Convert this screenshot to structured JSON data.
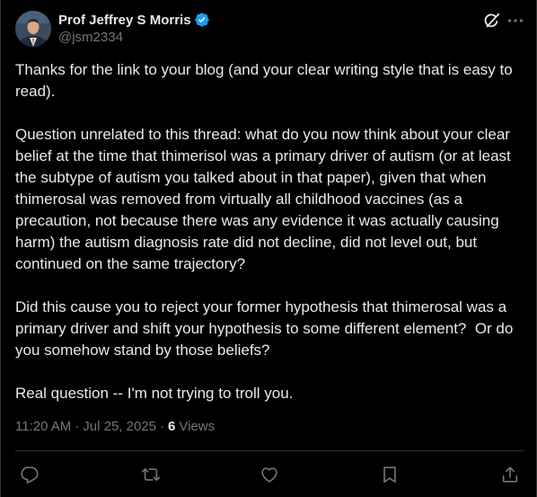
{
  "author": {
    "name": "Prof Jeffrey S Morris",
    "handle": "@jsm2334"
  },
  "tweet": {
    "paragraphs": [
      "Thanks for the link to your blog (and your clear writing style that is easy to read).",
      "Question unrelated to this thread: what do you now think about your clear belief at the time that thimerisol was a primary driver of autism (or at least the subtype of autism you talked about in that paper), given that when thimerosal was removed from virtually all childhood vaccines (as a precaution, not because there was any evidence it was actually causing harm) the autism diagnosis rate did not decline, did not level out, but continued on the same trajectory?",
      "Did this cause you to reject your former hypothesis that thimerosal was a primary driver and shift your hypothesis to some different element?  Or do you somehow stand by those beliefs?",
      "Real question -- I'm not trying to troll you."
    ],
    "time": "11:20 AM",
    "date": "Jul 25, 2025",
    "views_count": "6",
    "views_label": "Views",
    "separator": "·"
  },
  "colors": {
    "background": "#000000",
    "text": "#e7e9ea",
    "secondary_text": "#71767b",
    "verified_badge": "#1d9bf0",
    "border": "#2f3336"
  },
  "icons": {
    "verified": "verified-badge-icon",
    "grok": "grok-icon",
    "more": "more-icon",
    "reply": "reply-icon",
    "repost": "repost-icon",
    "like": "like-icon",
    "bookmark": "bookmark-icon",
    "share": "share-icon"
  }
}
